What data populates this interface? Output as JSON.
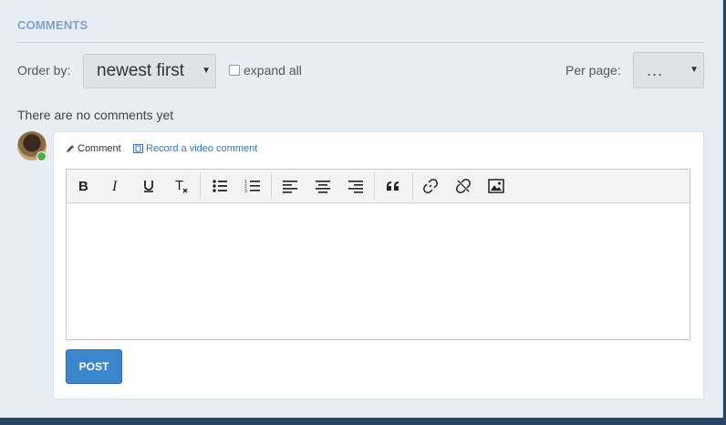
{
  "section": {
    "title": "COMMENTS"
  },
  "controls": {
    "order_label": "Order by:",
    "order_value": "newest first",
    "expand_label": "expand all",
    "per_page_label": "Per page:",
    "per_page_value": "..."
  },
  "status": {
    "empty_text": "There are no comments yet"
  },
  "composer": {
    "tab_comment": "Comment",
    "tab_video": "Record a video comment",
    "toolbar_icons": [
      "bold-icon",
      "italic-icon",
      "underline-icon",
      "clear-format-icon",
      "bulleted-list-icon",
      "numbered-list-icon",
      "align-left-icon",
      "align-center-icon",
      "align-right-icon",
      "blockquote-icon",
      "link-icon",
      "unlink-icon",
      "image-icon"
    ],
    "post_label": "POST"
  },
  "colors": {
    "accent": "#3b86cc",
    "header": "#7ea3c6",
    "online": "#4caf50",
    "link": "#3a78b8"
  }
}
